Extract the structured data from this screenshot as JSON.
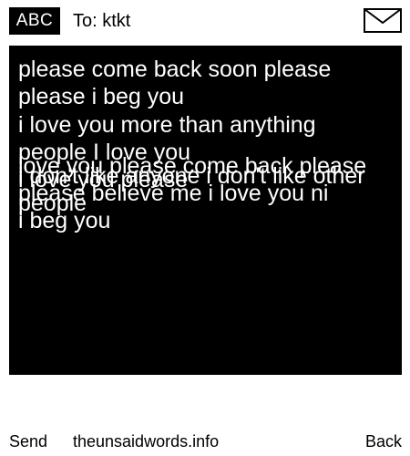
{
  "header": {
    "input_mode": "ABC",
    "recipient": "To: ktkt",
    "icon": "envelope-icon"
  },
  "message": {
    "layers": [
      "please come back soon please\nplease i beg you",
      "i love you more than anything\npeople I love you\ni love you please",
      "i don't like anyone i don't like other\npeople",
      "love you please come back please\nplease believe me i love you ni\ni beg you"
    ]
  },
  "softkeys": {
    "left": "Send",
    "center": "theunsaidwords.info",
    "right": "Back"
  },
  "colors": {
    "background": "#ffffff",
    "message_background": "#000000",
    "message_text": "#ffffff",
    "text": "#000000"
  }
}
